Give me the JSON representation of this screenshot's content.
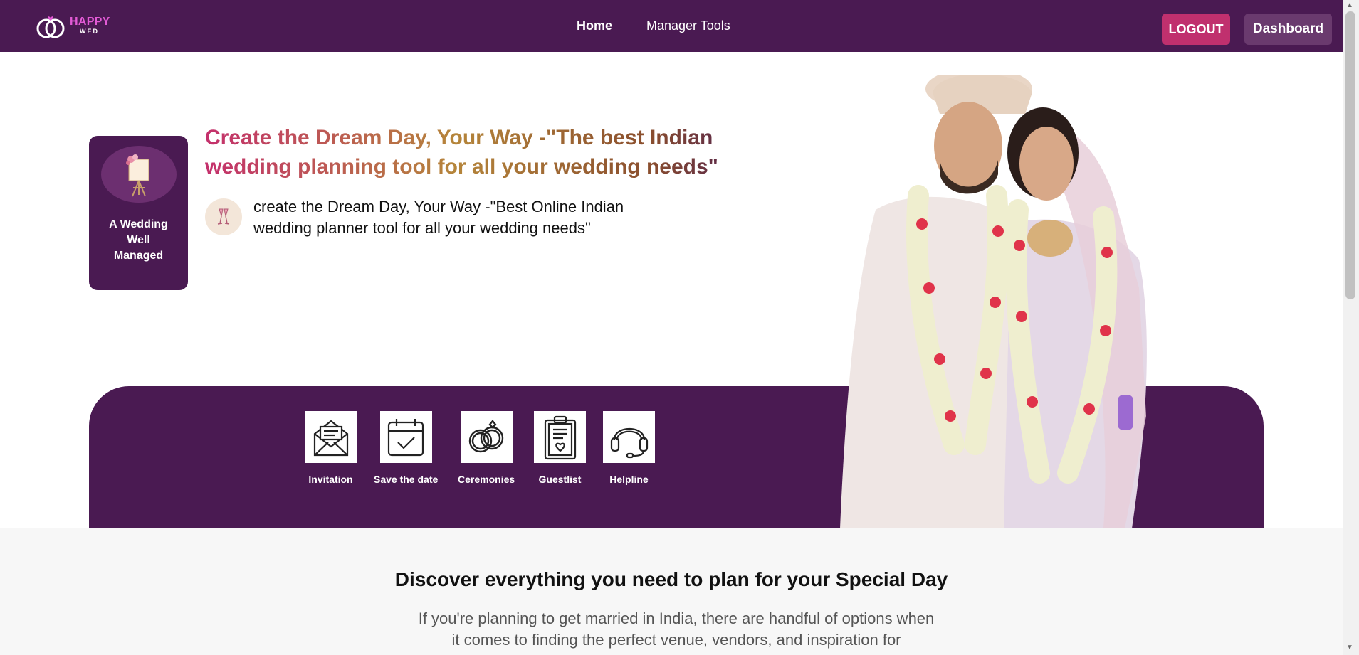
{
  "brand": {
    "name_line1": "HAPPY",
    "name_line2": "WED"
  },
  "nav": {
    "home": "Home",
    "manager_tools": "Manager Tools"
  },
  "header_buttons": {
    "logout": "LOGOUT",
    "dashboard": "Dashboard"
  },
  "hero": {
    "card_text": "A Wedding Well Managed",
    "title": "Create the Dream Day, Your Way -\"The best Indian wedding planning tool for all your wedding needs\"",
    "subtitle": "create the Dream Day, Your Way -\"Best Online Indian wedding planner tool for all your wedding needs\""
  },
  "tools": [
    {
      "label": "Invitation",
      "icon": "envelope-icon"
    },
    {
      "label": "Save the date",
      "icon": "calendar-check-icon"
    },
    {
      "label": "Ceremonies",
      "icon": "rings-icon"
    },
    {
      "label": "Guestlist",
      "icon": "clipboard-heart-icon"
    },
    {
      "label": "Helpline",
      "icon": "headset-icon"
    }
  ],
  "discover": {
    "title": "Discover everything you need to plan for your Special Day",
    "text": "If you're planning to get married in India, there are handful of options when it comes to finding the perfect venue, vendors, and inspiration for"
  },
  "colors": {
    "primary": "#4a1a52",
    "accent": "#c0306e",
    "logo_pink": "#e35bd6"
  }
}
